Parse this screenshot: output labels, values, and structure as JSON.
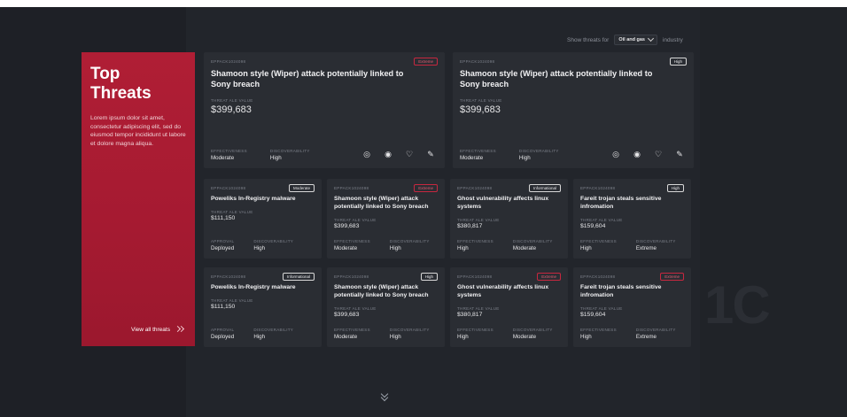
{
  "filter": {
    "prefix": "Show threats for",
    "selected": "Oil and gas",
    "suffix": "industry"
  },
  "hero": {
    "title": "Top Threats",
    "description": "Lorem ipsum dolor sit amet, consectetur adipiscing elit, sed do eiusmod tempor incididunt ut labore et dolore magna aliqua.",
    "view_all": "View all threats"
  },
  "labels": {
    "threat_ale": "THREAT ALE VALUE",
    "effectiveness": "EFFECTIVENESS",
    "discoverability": "DISCOVERABILITY",
    "approval": "APPROVAL"
  },
  "big_cards": [
    {
      "code": "EPPACK1024098",
      "badge": "Extreme",
      "badge_type": "extreme",
      "title": "Shamoon style (Wiper) attack potentially linked to Sony breach",
      "value": "$399,683",
      "m1": "Moderate",
      "m2": "High",
      "icons": [
        "target-icon",
        "eye-icon",
        "heart-icon",
        "edit-icon"
      ]
    },
    {
      "code": "EPPACK1024098",
      "badge": "High",
      "badge_type": "normal",
      "title": "Shamoon style (Wiper) attack potentially linked to Sony breach",
      "value": "$399,683",
      "m1": "Moderate",
      "m2": "High",
      "icons": [
        "target-icon",
        "eye-icon",
        "heart-icon",
        "edit-icon"
      ]
    }
  ],
  "small_cards": [
    {
      "code": "EPPACK1024098",
      "badge": "Moderate",
      "badge_type": "normal",
      "title": "Poweliks In-Registry malware",
      "value": "$111,150",
      "l1": "APPROVAL",
      "m1": "Deployed",
      "m2": "High"
    },
    {
      "code": "EPPACK1024098",
      "badge": "Extreme",
      "badge_type": "extreme",
      "title": "Shamoon style (Wiper) attack potentially linked to Sony breach",
      "value": "$399,683",
      "l1": "EFFECTIVENESS",
      "m1": "Moderate",
      "m2": "High"
    },
    {
      "code": "EPPACK1024098",
      "badge": "Informational",
      "badge_type": "normal",
      "title": "Ghost vulnerability affects linux systems",
      "value": "$380,817",
      "l1": "EFFECTIVENESS",
      "m1": "High",
      "m2": "Moderate"
    },
    {
      "code": "EPPACK1024098",
      "badge": "High",
      "badge_type": "normal",
      "title": "Fareit trojan steals sensitive infromation",
      "value": "$159,604",
      "l1": "EFFECTIVENESS",
      "m1": "High",
      "m2": "Extreme"
    },
    {
      "code": "EPPACK1024098",
      "badge": "Informational",
      "badge_type": "normal",
      "title": "Poweliks In-Registry malware",
      "value": "$111,150",
      "l1": "APPROVAL",
      "m1": "Deployed",
      "m2": "High"
    },
    {
      "code": "EPPACK1024098",
      "badge": "High",
      "badge_type": "normal",
      "title": "Shamoon style (Wiper) attack potentially linked to Sony breach",
      "value": "$399,683",
      "l1": "EFFECTIVENESS",
      "m1": "Moderate",
      "m2": "High"
    },
    {
      "code": "EPPACK1024098",
      "badge": "Extreme",
      "badge_type": "extreme",
      "title": "Ghost vulnerability affects linux systems",
      "value": "$380,817",
      "l1": "EFFECTIVENESS",
      "m1": "High",
      "m2": "Moderate"
    },
    {
      "code": "EPPACK1024098",
      "badge": "Extreme",
      "badge_type": "extreme",
      "title": "Fareit trojan steals sensitive infromation",
      "value": "$159,604",
      "l1": "EFFECTIVENESS",
      "m1": "High",
      "m2": "Extreme"
    }
  ],
  "watermark": "1C",
  "colors": {
    "accent": "#b01e35",
    "background": "#1a1c21",
    "card": "#2a2d33",
    "extreme": "#c7273f"
  }
}
